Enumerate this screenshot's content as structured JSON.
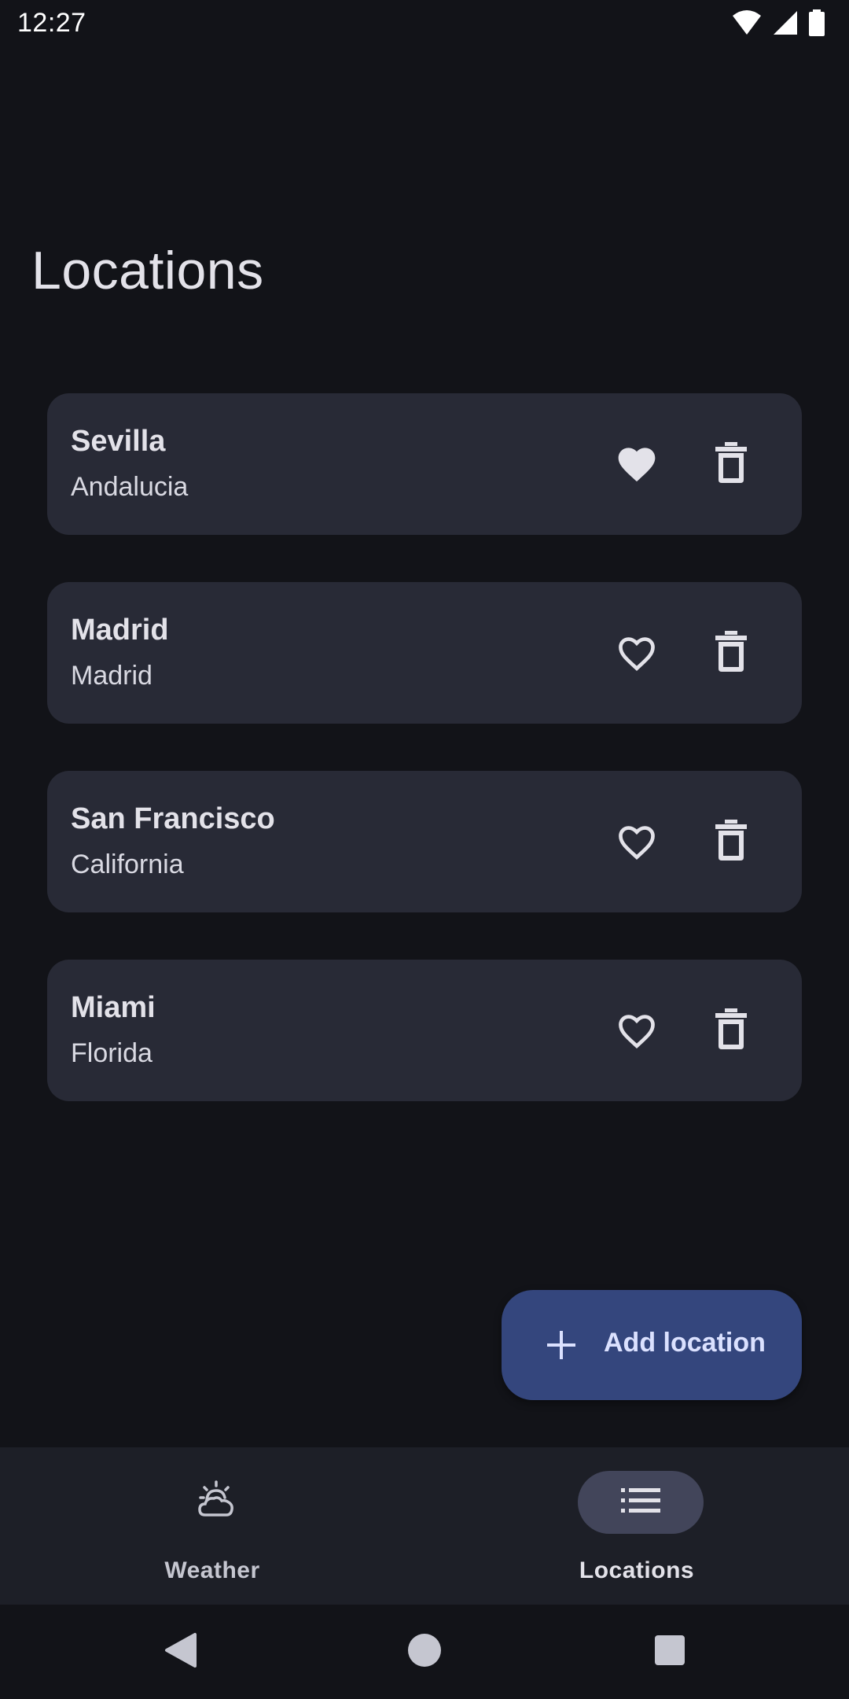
{
  "status_bar": {
    "time": "12:27",
    "icons": [
      "wifi-icon",
      "signal-icon",
      "battery-icon"
    ]
  },
  "page": {
    "title": "Locations"
  },
  "locations": [
    {
      "name": "Sevilla",
      "region": "Andalucia",
      "favorite": true
    },
    {
      "name": "Madrid",
      "region": "Madrid",
      "favorite": false
    },
    {
      "name": "San Francisco",
      "region": "California",
      "favorite": false
    },
    {
      "name": "Miami",
      "region": "Florida",
      "favorite": false
    }
  ],
  "fab": {
    "label": "Add location",
    "icon": "plus-icon"
  },
  "bottom_nav": {
    "items": [
      {
        "label": "Weather",
        "icon": "weather-icon",
        "selected": false
      },
      {
        "label": "Locations",
        "icon": "list-icon",
        "selected": true
      }
    ]
  },
  "system_nav": {
    "icons": [
      "back-icon",
      "home-icon",
      "recents-icon"
    ]
  },
  "colors": {
    "background": "#121318",
    "card": "#282a36",
    "fab": "#34467d",
    "nav_bar": "#1d1f27",
    "nav_indicator": "#42455a"
  }
}
